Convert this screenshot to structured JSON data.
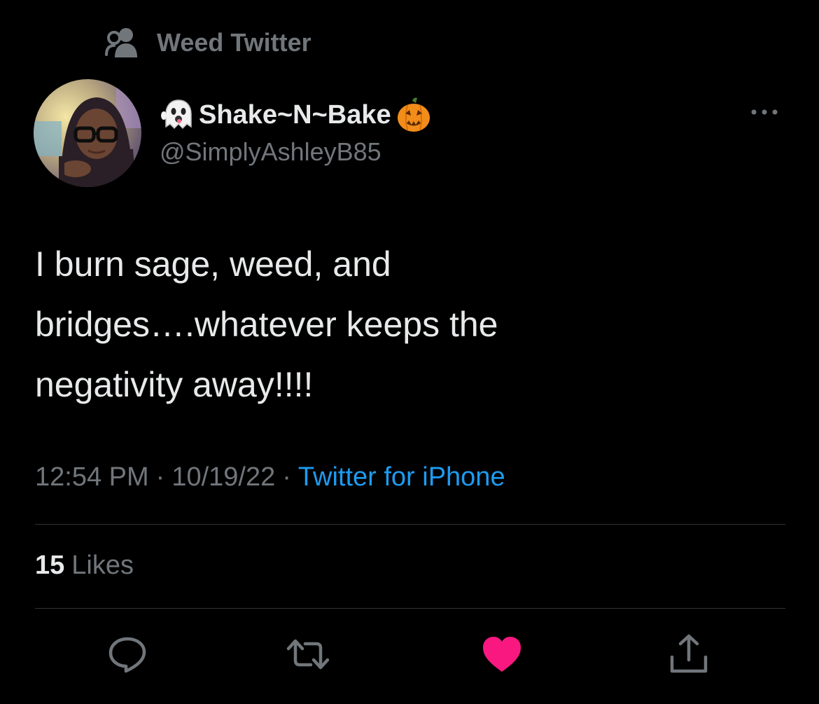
{
  "social_context": {
    "label": "Weed Twitter",
    "icon": "community-icon"
  },
  "author": {
    "display_name": "Shake~N~Bake",
    "handle": "@SimplyAshleyB85",
    "name_prefix_emoji": "ghost-emoji",
    "name_suffix_emoji": "jack-o-lantern-emoji"
  },
  "tweet": {
    "lines": [
      "I burn sage, weed, and",
      "bridges….whatever keeps the",
      "negativity away!!!!"
    ]
  },
  "meta": {
    "time": "12:54 PM",
    "date": "10/19/22",
    "separator": "·",
    "source": "Twitter for iPhone"
  },
  "stats": {
    "likes_count": "15",
    "likes_label": "Likes"
  },
  "actions": [
    {
      "name": "reply",
      "icon": "reply-icon",
      "liked": false
    },
    {
      "name": "retweet",
      "icon": "retweet-icon",
      "liked": false
    },
    {
      "name": "like",
      "icon": "heart-icon",
      "liked": true
    },
    {
      "name": "share",
      "icon": "share-icon",
      "liked": false
    }
  ],
  "colors": {
    "background": "#000000",
    "text_primary": "#e7e9ea",
    "text_secondary": "#71767b",
    "link": "#1d9bf0",
    "like": "#f91880",
    "divider": "#2f3336"
  }
}
